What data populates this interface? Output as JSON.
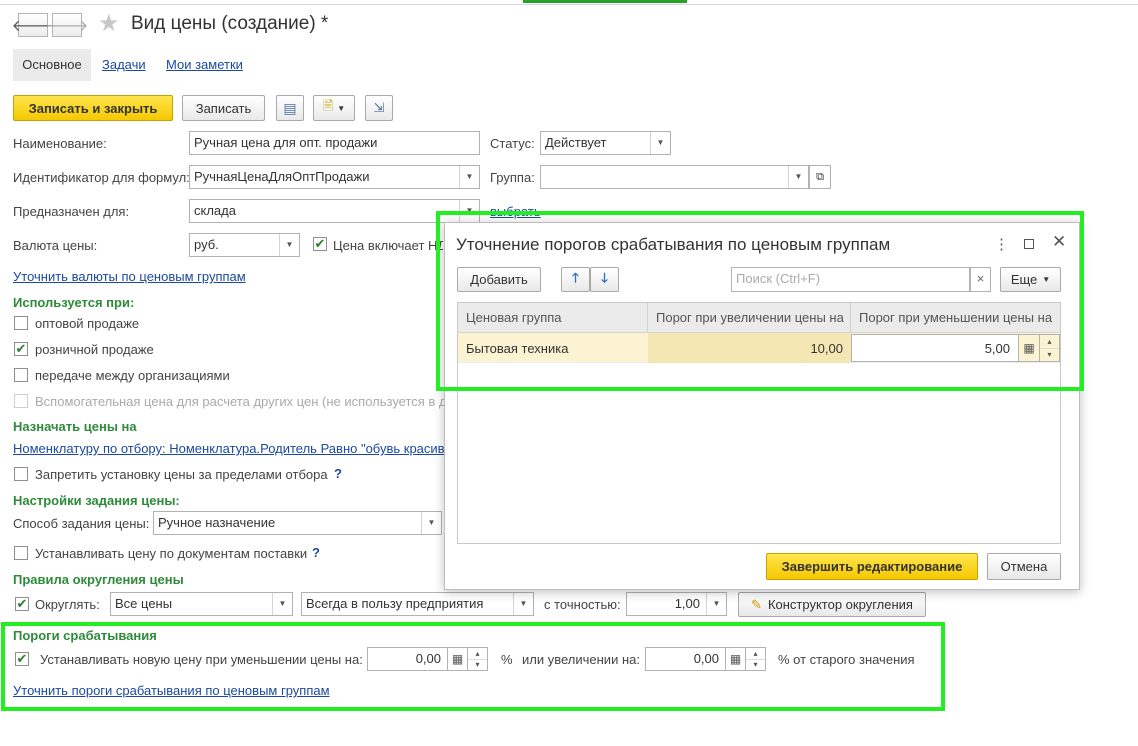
{
  "window": {
    "title": "Вид цены (создание) *"
  },
  "nav": {
    "back": "🡐",
    "forward": "🡒"
  },
  "tabs": [
    "Основное",
    "Задачи",
    "Мои заметки"
  ],
  "toolbar": {
    "save_close": "Записать и закрыть",
    "save": "Записать"
  },
  "form": {
    "name_label": "Наименование:",
    "name_value": "Ручная цена для опт. продажи",
    "status_label": "Статус:",
    "status_value": "Действует",
    "formula_id_label": "Идентификатор для формул:",
    "formula_id_value": "РучнаяЦенаДляОптПродажи",
    "group_label": "Группа:",
    "group_value": "",
    "purpose_label": "Предназначен для:",
    "purpose_value": "склада",
    "purpose_link": "выбрать",
    "currency_label": "Валюта цены:",
    "currency_value": "руб.",
    "vat_label": "Цена включает НДС",
    "currency_groups_link": "Уточнить валюты по ценовым группам"
  },
  "used_for": {
    "title": "Используется при:",
    "items": [
      {
        "label": "оптовой продаже",
        "checked": false
      },
      {
        "label": "розничной продаже",
        "checked": true
      },
      {
        "label": "передаче между организациями",
        "checked": false
      },
      {
        "label": "Вспомогательная цена для расчета других цен (не используется в документах)",
        "checked": false
      }
    ]
  },
  "assign": {
    "title": "Назначать цены на",
    "filter_link": "Номенклатуру по отбору: Номенклатура.Родитель Равно \"обувь красивая\"",
    "restrict_label": "Запретить установку цены за пределами отбора",
    "help": "?"
  },
  "settings": {
    "title": "Настройки задания цены:",
    "method_label": "Способ задания цены:",
    "method_value": "Ручное назначение",
    "supply_label": "Устанавливать цену по документам поставки",
    "help": "?"
  },
  "rounding": {
    "title": "Правила округления цены",
    "round_label": "Округлять:",
    "scope_value": "Все цены",
    "direction_value": "Всегда в пользу предприятия",
    "precision_label": "с точностью:",
    "precision_value": "1,00",
    "constructor_label": "Конструктор округления"
  },
  "thresholds": {
    "title": "Пороги срабатывания",
    "set_label": "Устанавливать новую цену при уменьшении цены на:",
    "decrease_value": "0,00",
    "percent": "%",
    "or_increase_label": "или увеличении на:",
    "increase_value": "0,00",
    "of_old_label": "% от старого значения",
    "groups_link": "Уточнить пороги срабатывания по ценовым группам"
  },
  "dialog": {
    "title": "Уточнение порогов срабатывания по ценовым группам",
    "add_label": "Добавить",
    "search_placeholder": "Поиск (Ctrl+F)",
    "more_label": "Еще",
    "columns": [
      "Ценовая группа",
      "Порог при увеличении цены на",
      "Порог при уменьшении цены на"
    ],
    "rows": [
      {
        "group": "Бытовая техника",
        "increase": "10,00",
        "decrease": "5,00"
      }
    ],
    "finish_label": "Завершить редактирование",
    "cancel_label": "Отмена"
  },
  "colors": {
    "highlight": "#22ee22",
    "section": "#2e8b3a",
    "link": "#1c49a0",
    "primary": "#f5c800"
  }
}
